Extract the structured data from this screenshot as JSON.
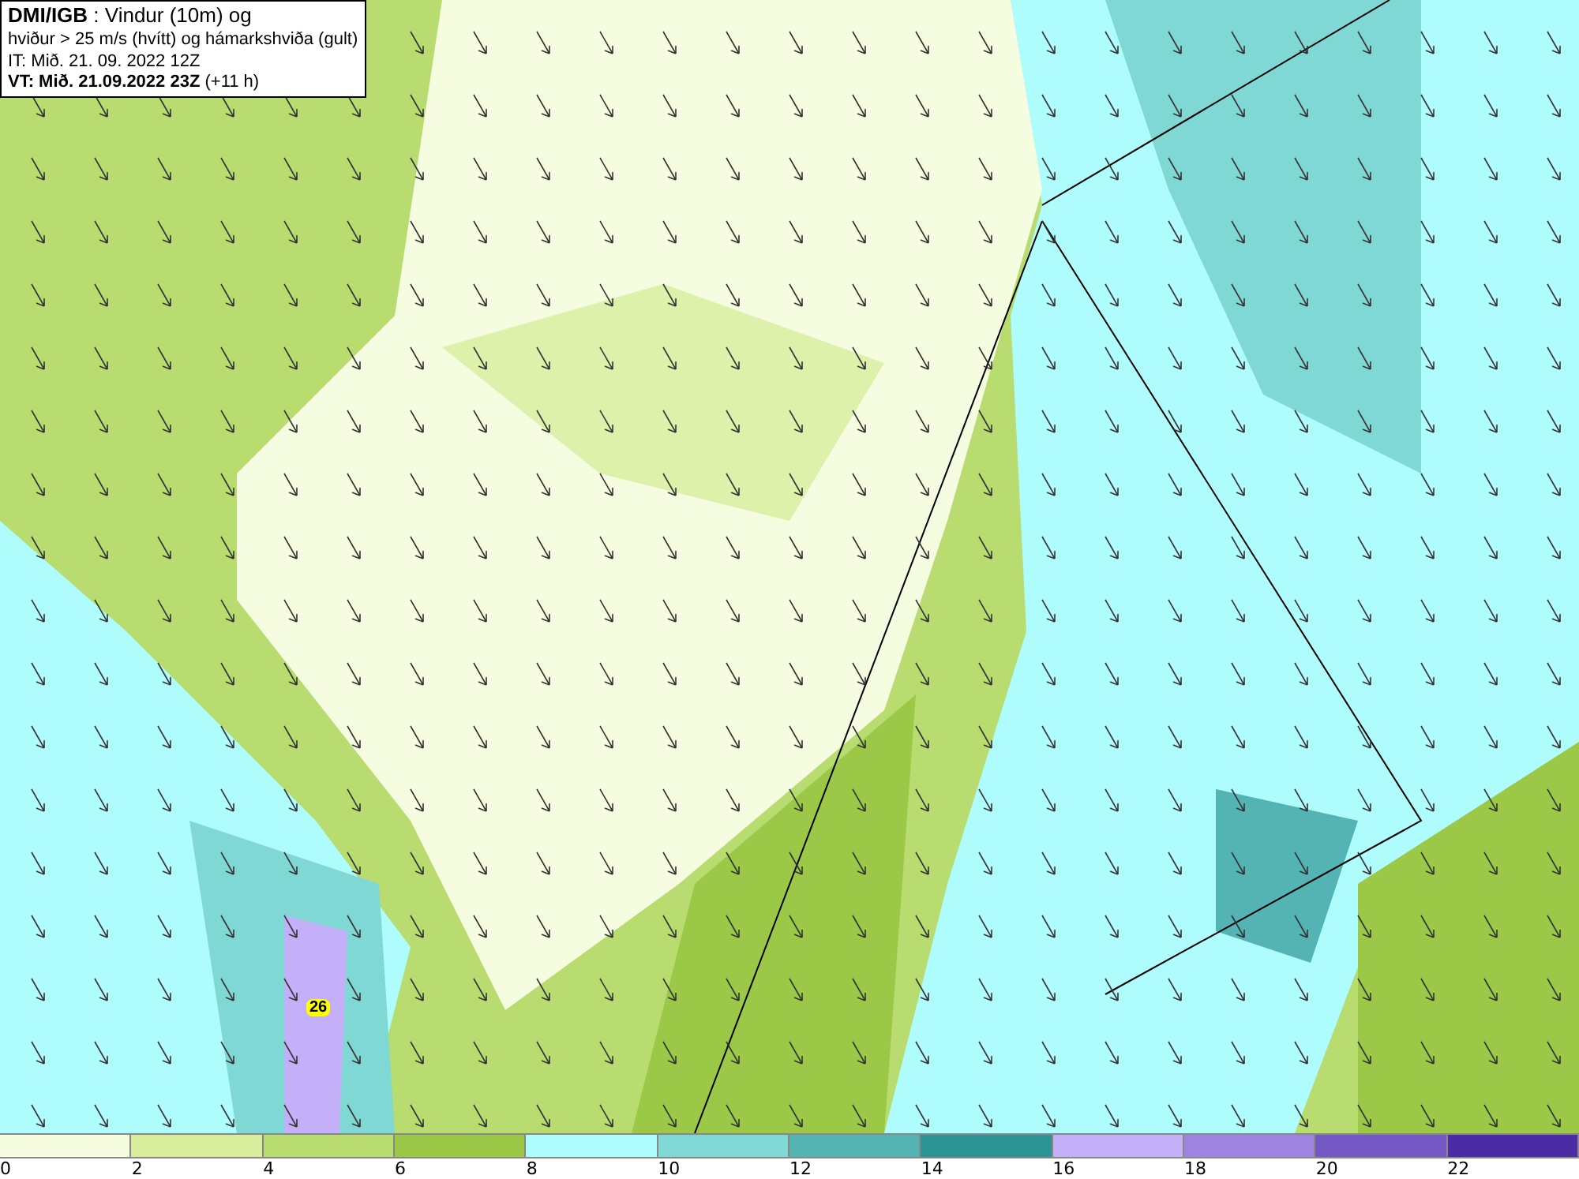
{
  "info_box": {
    "lines": [
      "**DMI/IGB** : Vindur (10m) og",
      "hviður > 25 m/s (hvítt) og hámarkshviða (gult)",
      "IT: Mið. 21. 09. 2022 12Z",
      "**VT: Mið. 21.09.2022 23Z** (+11 h)"
    ]
  },
  "map": {
    "max_gust": "26"
  },
  "colorbar": [
    {
      "label": "0",
      "color": "#f5fce0"
    },
    {
      "label": "2",
      "color": "#d8ee9c"
    },
    {
      "label": "4",
      "color": "#b8dc70"
    },
    {
      "label": "6",
      "color": "#9cc848"
    },
    {
      "label": "8",
      "color": "#aefcfc"
    },
    {
      "label": "10",
      "color": "#80d8d4"
    },
    {
      "label": "12",
      "color": "#54b4b4"
    },
    {
      "label": "14",
      "color": "#2c9494"
    },
    {
      "label": "16",
      "color": "#c4b0f8"
    },
    {
      "label": "18",
      "color": "#9c84e0"
    },
    {
      "label": "20",
      "color": "#7458c4"
    },
    {
      "label": "22",
      "color": "#4c2ca4"
    }
  ]
}
